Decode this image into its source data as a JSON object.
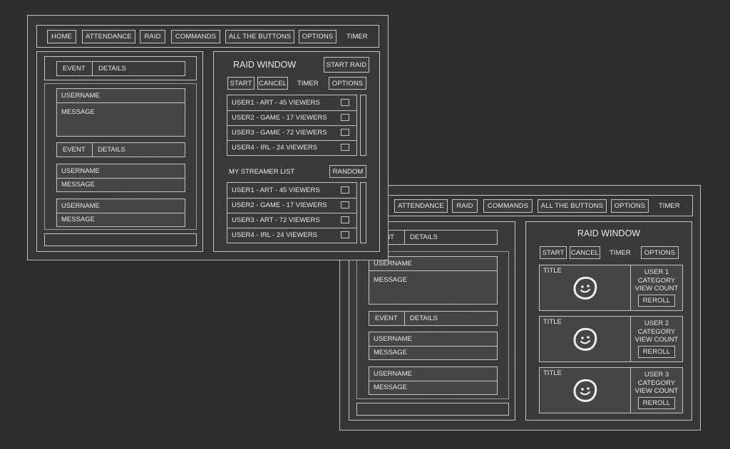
{
  "nav": {
    "home": "HOME",
    "attendance": "ATTENDANCE",
    "raid": "RAID",
    "commands": "COMMANDS",
    "all_buttons": "ALL THE BUTTONS",
    "options": "OPTIONS",
    "timer": "TIMER"
  },
  "feed": {
    "event": "EVENT",
    "details": "DETAILS",
    "username": "USERNAME",
    "message": "MESSAGE"
  },
  "raid": {
    "title": "RAID WINDOW",
    "start_raid": "START RAID",
    "start": "START",
    "cancel": "CANCEL",
    "timer": "TIMER",
    "options": "OPTIONS",
    "list_label": "MY STREAMER LIST",
    "random": "RANDOM",
    "users": [
      "USER1 - ART - 45 VIEWERS",
      "USER2 - GAME - 17 VIEWERS",
      "USER3 -  GAME - 72 VIEWERS",
      "USER4 - IRL - 24 VIEWERS"
    ],
    "streamers": [
      "USER1 - ART - 45 VIEWERS",
      "USER2 - GAME - 17 VIEWERS",
      "USER3 -  ART - 72 VIEWERS",
      "USER4 - IRL - 24 VIEWERS"
    ]
  },
  "raid_cards": {
    "title": "TITLE",
    "reroll": "REROLL",
    "category": "CATEGORY",
    "view_count": "VIEW COUNT",
    "users": [
      "USER 1",
      "USER 2",
      "USER 3"
    ]
  },
  "icons": {
    "thumbnail": "smiley-face-icon",
    "checkbox": "checkbox-icon"
  },
  "colors": {
    "background": "#2e2e2e",
    "window": "#363636",
    "card": "#454545",
    "stroke": "#c4c4c4",
    "text": "#e8e8e8"
  }
}
